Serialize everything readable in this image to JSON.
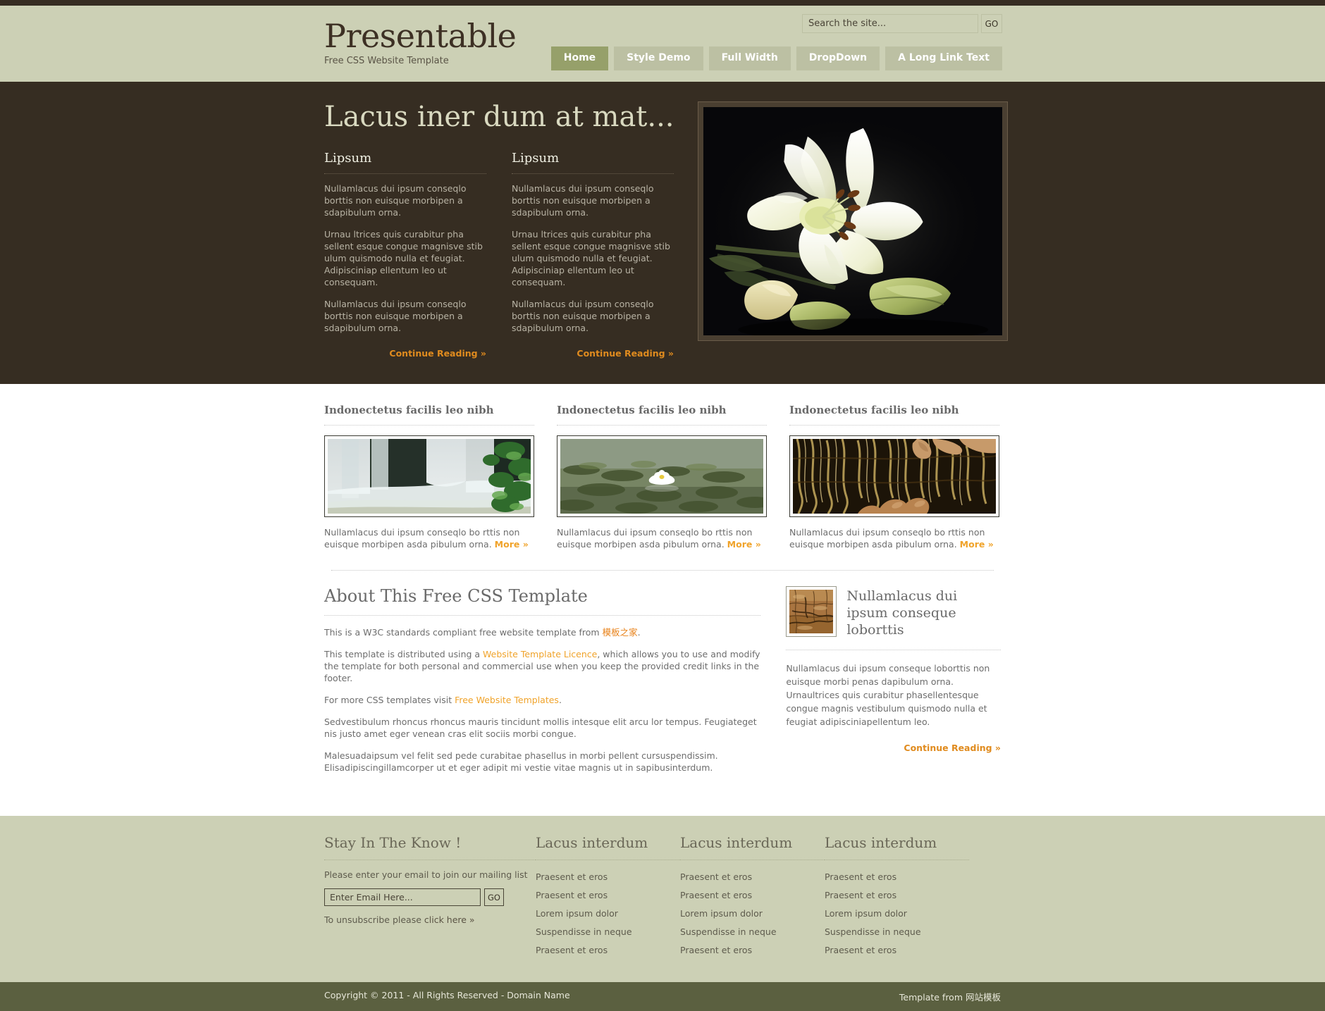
{
  "header": {
    "brand_title": "Presentable",
    "brand_tagline": "Free CSS Website Template",
    "search": {
      "placeholder": "Search the site...",
      "value": "",
      "go_label": "GO"
    },
    "nav": [
      {
        "label": "Home",
        "active": true
      },
      {
        "label": "Style Demo",
        "active": false
      },
      {
        "label": "Full Width",
        "active": false
      },
      {
        "label": "DropDown",
        "active": false
      },
      {
        "label": "A Long Link Text",
        "active": false
      }
    ]
  },
  "hero": {
    "title": "Lacus iner dum at mat...",
    "columns": [
      {
        "heading": "Lipsum",
        "p1": "Nullamlacus dui ipsum conseqlo borttis non euisque morbipen a sdapibulum orna.",
        "p2": "Urnau ltrices quis curabitur pha sellent esque congue magnisve stib ulum quismodo nulla et feugiat. Adipisciniap ellentum leo ut consequam.",
        "p3": "Nullamlacus dui ipsum conseqlo borttis non euisque morbipen a sdapibulum orna.",
        "link": "Continue Reading »"
      },
      {
        "heading": "Lipsum",
        "p1": "Nullamlacus dui ipsum conseqlo borttis non euisque morbipen a sdapibulum orna.",
        "p2": "Urnau ltrices quis curabitur pha sellent esque congue magnisve stib ulum quismodo nulla et feugiat. Adipisciniap ellentum leo ut consequam.",
        "p3": "Nullamlacus dui ipsum conseqlo borttis non euisque morbipen a sdapibulum orna.",
        "link": "Continue Reading »"
      }
    ],
    "image_alt": "white-lily-flower-photo"
  },
  "features": [
    {
      "heading": "Indonectetus facilis leo nibh",
      "text": "Nullamlacus dui ipsum conseqlo bo rttis non euisque morbipen asda pibulum orna. ",
      "more": "More »",
      "image_alt": "waterfall-photo"
    },
    {
      "heading": "Indonectetus facilis leo nibh",
      "text": "Nullamlacus dui ipsum conseqlo bo rttis non euisque morbipen asda pibulum orna. ",
      "more": "More »",
      "image_alt": "water-lily-pond-photo"
    },
    {
      "heading": "Indonectetus facilis leo nibh",
      "text": "Nullamlacus dui ipsum conseqlo bo rttis non euisque morbipen asda pibulum orna. ",
      "more": "More »",
      "image_alt": "tree-bark-hands-photo"
    }
  ],
  "about": {
    "title": "About This Free CSS Template",
    "p1_pre": "This is a W3C standards compliant free website template from ",
    "p1_link": "模板之家",
    "p1_post": ".",
    "p2_pre": "This template is distributed using a ",
    "p2_link": "Website Template Licence",
    "p2_post": ", which allows you to use and modify the template for both personal and commercial use when you keep the provided credit links in the footer.",
    "p3_pre": "For more CSS templates visit ",
    "p3_link": "Free Website Templates",
    "p3_post": ".",
    "p4": "Sedvestibulum rhoncus rhoncus mauris tincidunt mollis intesque elit arcu lor tempus. Feugiateget nis justo amet eger venean cras elit sociis morbi congue.",
    "p5": "Malesuadaipsum vel felit sed pede curabitae phasellus in morbi pellent cursuspendissim. Elisadipiscingillamcorper ut et eger adipit mi vestie vitae magnis ut in sapibusinterdum."
  },
  "about_side": {
    "heading": "Nullamlacus dui ipsum conseque loborttis",
    "body": "Nullamlacus dui ipsum conseque loborttis non euisque morbi penas dapibulum orna. Urnaultrices quis curabitur phasellentesque congue magnis vestibulum quismodo nulla et feugiat adipisciniapellentum leo.",
    "link": "Continue Reading »",
    "image_alt": "dry-cracked-earth-thumbnail"
  },
  "footer": {
    "newsletter": {
      "title": "Stay In The Know !",
      "subtitle": "Please enter your email to join our mailing list",
      "email_placeholder": "Enter Email Here...",
      "email_value": "",
      "go_label": "GO",
      "unsub_pre": "To unsubscribe please ",
      "unsub_link": "click here »"
    },
    "link_columns": [
      {
        "title": "Lacus interdum",
        "items": [
          "Praesent et eros",
          "Praesent et eros",
          "Lorem ipsum dolor",
          "Suspendisse in neque",
          "Praesent et eros"
        ]
      },
      {
        "title": "Lacus interdum",
        "items": [
          "Praesent et eros",
          "Praesent et eros",
          "Lorem ipsum dolor",
          "Suspendisse in neque",
          "Praesent et eros"
        ]
      },
      {
        "title": "Lacus interdum",
        "items": [
          "Praesent et eros",
          "Praesent et eros",
          "Lorem ipsum dolor",
          "Suspendisse in neque",
          "Praesent et eros"
        ]
      }
    ],
    "copyright": "Copyright © 2011 - All Rights Reserved - Domain Name",
    "credit_pre": "Template from ",
    "credit_link": "网站模板"
  },
  "colors": {
    "header_bg": "#ccd0b5",
    "dark_bg": "#362d22",
    "accent_orange": "#f0a32a",
    "nav_active": "#96a06a",
    "copybar_bg": "#5b6040"
  }
}
